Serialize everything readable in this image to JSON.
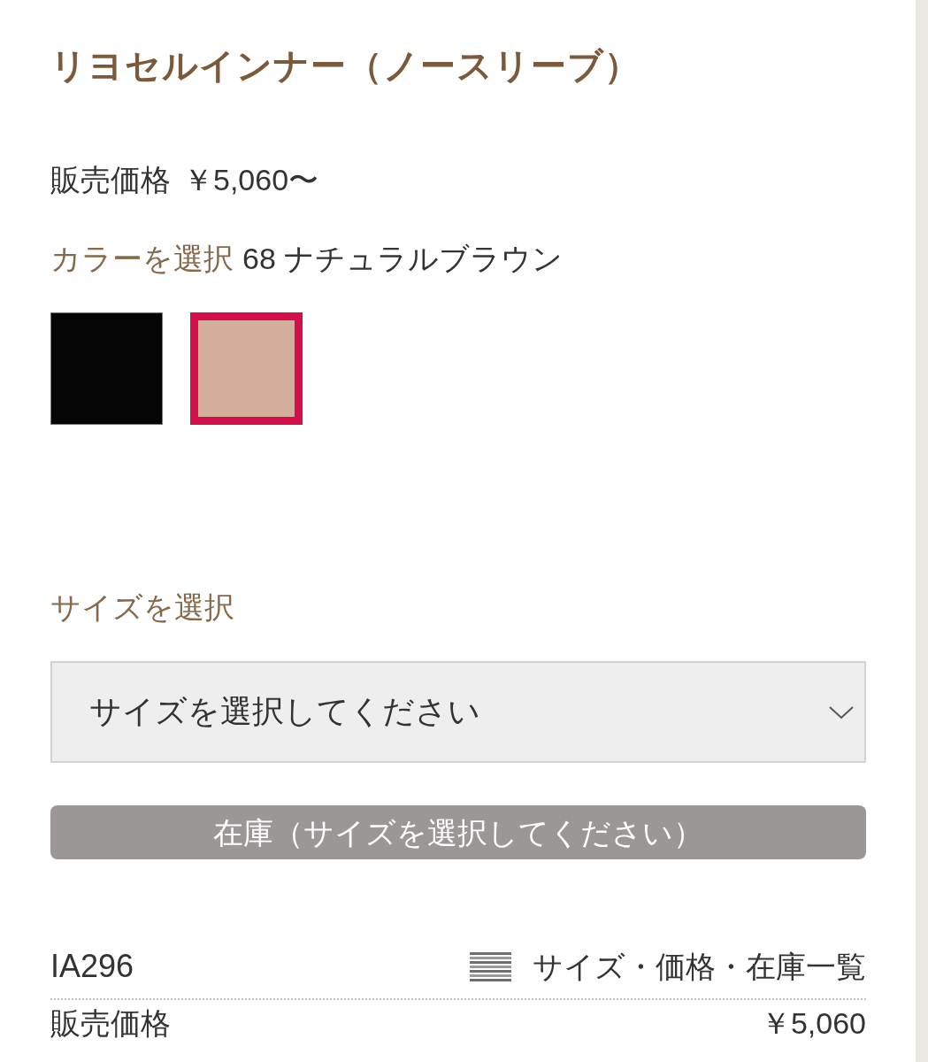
{
  "product": {
    "title": "リヨセルインナー（ノースリーブ）"
  },
  "price": {
    "label": "販売価格",
    "value": "￥5,060〜"
  },
  "color_picker": {
    "label": "カラーを選択",
    "selected_name": "68 ナチュラルブラウン",
    "swatches": [
      {
        "color": "#050505",
        "selected": false
      },
      {
        "color": "#d3ae9c",
        "selected": true
      }
    ]
  },
  "size_picker": {
    "label": "サイズを選択",
    "dropdown": {
      "placeholder": "サイズを選択してください"
    }
  },
  "stock_button": {
    "label": "在庫（サイズを選択してください）",
    "disabled": true
  },
  "sku_row": {
    "code": "IA296",
    "link": "サイズ・価格・在庫一覧"
  },
  "price_row": {
    "label": "販売価格",
    "value": "￥5,060"
  }
}
